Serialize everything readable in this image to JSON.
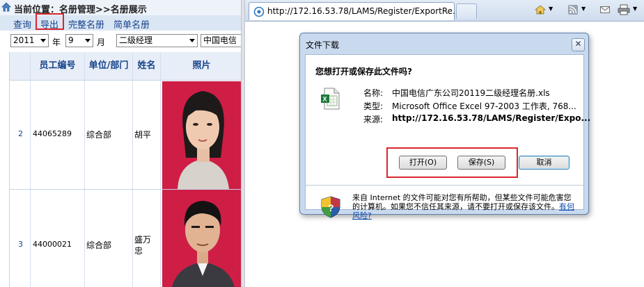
{
  "app": {
    "breadcrumb": "当前位置：名册管理>>名册展示",
    "toolbar": {
      "query": "查询",
      "export": "导出",
      "full_roster": "完整名册",
      "simple_roster": "简单名册"
    },
    "filters": {
      "year": "2011",
      "year_unit": "年",
      "month": "9",
      "month_unit": "月",
      "level": "二级经理",
      "company": "中国电信"
    },
    "grid": {
      "headers": [
        "员工编号",
        "单位/部门",
        "姓名",
        "照片"
      ],
      "rows": [
        {
          "index": "2",
          "employee_id": "44065289",
          "department": "综合部",
          "name": "胡平"
        },
        {
          "index": "3",
          "employee_id": "44000021",
          "department": "综合部",
          "name": "盛万\n忠"
        }
      ]
    }
  },
  "browser": {
    "tab_url": "http://172.16.53.78/LAMS/Register/ExportRe...",
    "icons": [
      "ie-page-icon",
      "home-icon",
      "rss-icon",
      "mail-icon",
      "print-icon"
    ]
  },
  "dialog": {
    "title": "文件下载",
    "question": "您想打开或保存此文件吗?",
    "name_label": "名称:",
    "name_value": "中国电信广东公司20119二级经理名册.xls",
    "type_label": "类型:",
    "type_value": "Microsoft Office Excel 97-2003 工作表, 768...",
    "source_label": "来源:",
    "source_value": "http://172.16.53.78/LAMS/Register/Expo...",
    "open_button": "打开(O)",
    "save_button": "保存(S)",
    "cancel_button": "取消",
    "close_glyph": "✕",
    "warning_text": "来自 Internet 的文件可能对您有所帮助，但某些文件可能危害您的计算机。如果您不信任其来源，请不要打开或保存该文件。",
    "risk_link": "有何风险?"
  },
  "colors": {
    "highlight": "#d9262c",
    "photo_bg": "#ce1e45",
    "link": "#15428b"
  }
}
